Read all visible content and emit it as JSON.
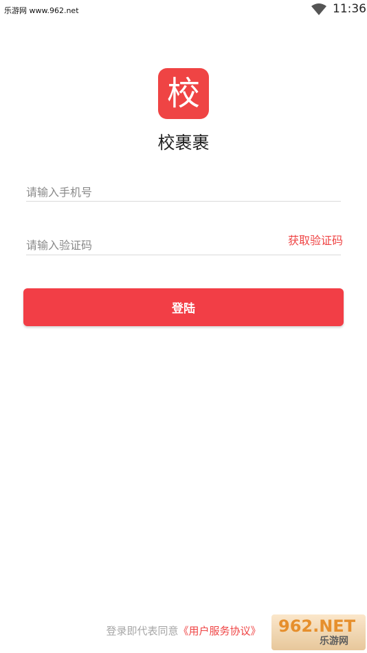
{
  "status_bar": {
    "watermark": "乐游网 www.962.net",
    "time": "11:36"
  },
  "app": {
    "icon_char": "校",
    "name": "校裹裹"
  },
  "form": {
    "phone_placeholder": "请输入手机号",
    "code_placeholder": "请输入验证码",
    "get_code_label": "获取验证码",
    "login_label": "登陆"
  },
  "footer": {
    "agreement_prefix": "登录即代表同意",
    "agreement_link": "《用户服务协议》"
  },
  "badge": {
    "line1": "962.NET",
    "line2": "乐游网"
  },
  "colors": {
    "accent": "#ef4444",
    "button": "#f23e46"
  }
}
